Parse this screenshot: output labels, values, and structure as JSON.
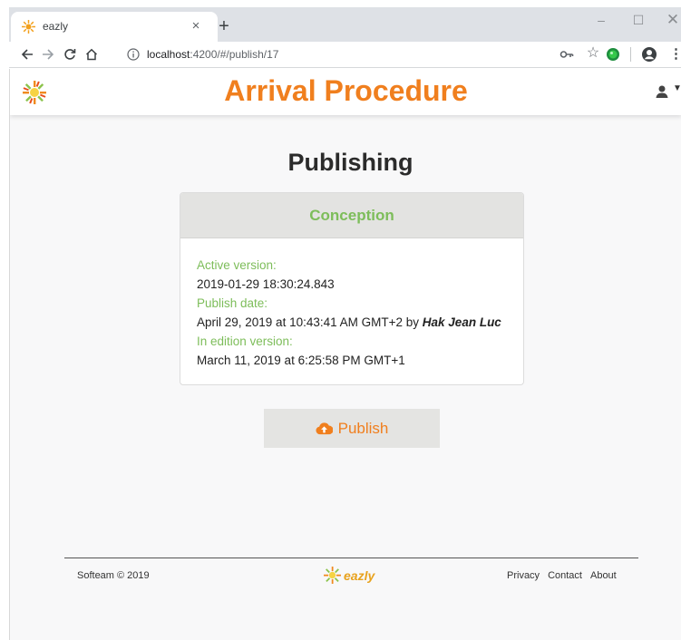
{
  "browser": {
    "tab_title": "eazly",
    "tab_close": "×",
    "new_tab": "+",
    "window_controls": {
      "minimize": "–",
      "maximize": "☐",
      "close": "✕"
    },
    "url_host": "localhost",
    "url_rest": ":4200/#/publish/17",
    "icons": [
      "back-arrow-icon",
      "forward-arrow-icon",
      "reload-icon",
      "home-icon",
      "info-icon",
      "key-icon",
      "star-icon",
      "extension-icon",
      "profile-icon",
      "menu-dots-icon"
    ]
  },
  "app": {
    "title": "Arrival Procedure",
    "brand_color": "#f07f1e",
    "accent_color": "#7dbd5a"
  },
  "page": {
    "heading": "Publishing"
  },
  "card": {
    "title": "Conception",
    "active_version_label": "Active version:",
    "active_version_value": "2019-01-29 18:30:24.843",
    "publish_date_label": "Publish date:",
    "publish_date_value": "April 29, 2019 at 10:43:41 AM GMT+2 by ",
    "publish_author": "Hak Jean Luc",
    "edition_version_label": "In edition version:",
    "edition_version_value": "March 11, 2019 at 6:25:58 PM GMT+1"
  },
  "publish_button": {
    "label": "Publish",
    "icon": "cloud-upload-icon"
  },
  "footer": {
    "copyright": "Softeam © 2019",
    "logo_text": "eazly",
    "links": [
      "Privacy",
      "Contact",
      "About"
    ]
  }
}
